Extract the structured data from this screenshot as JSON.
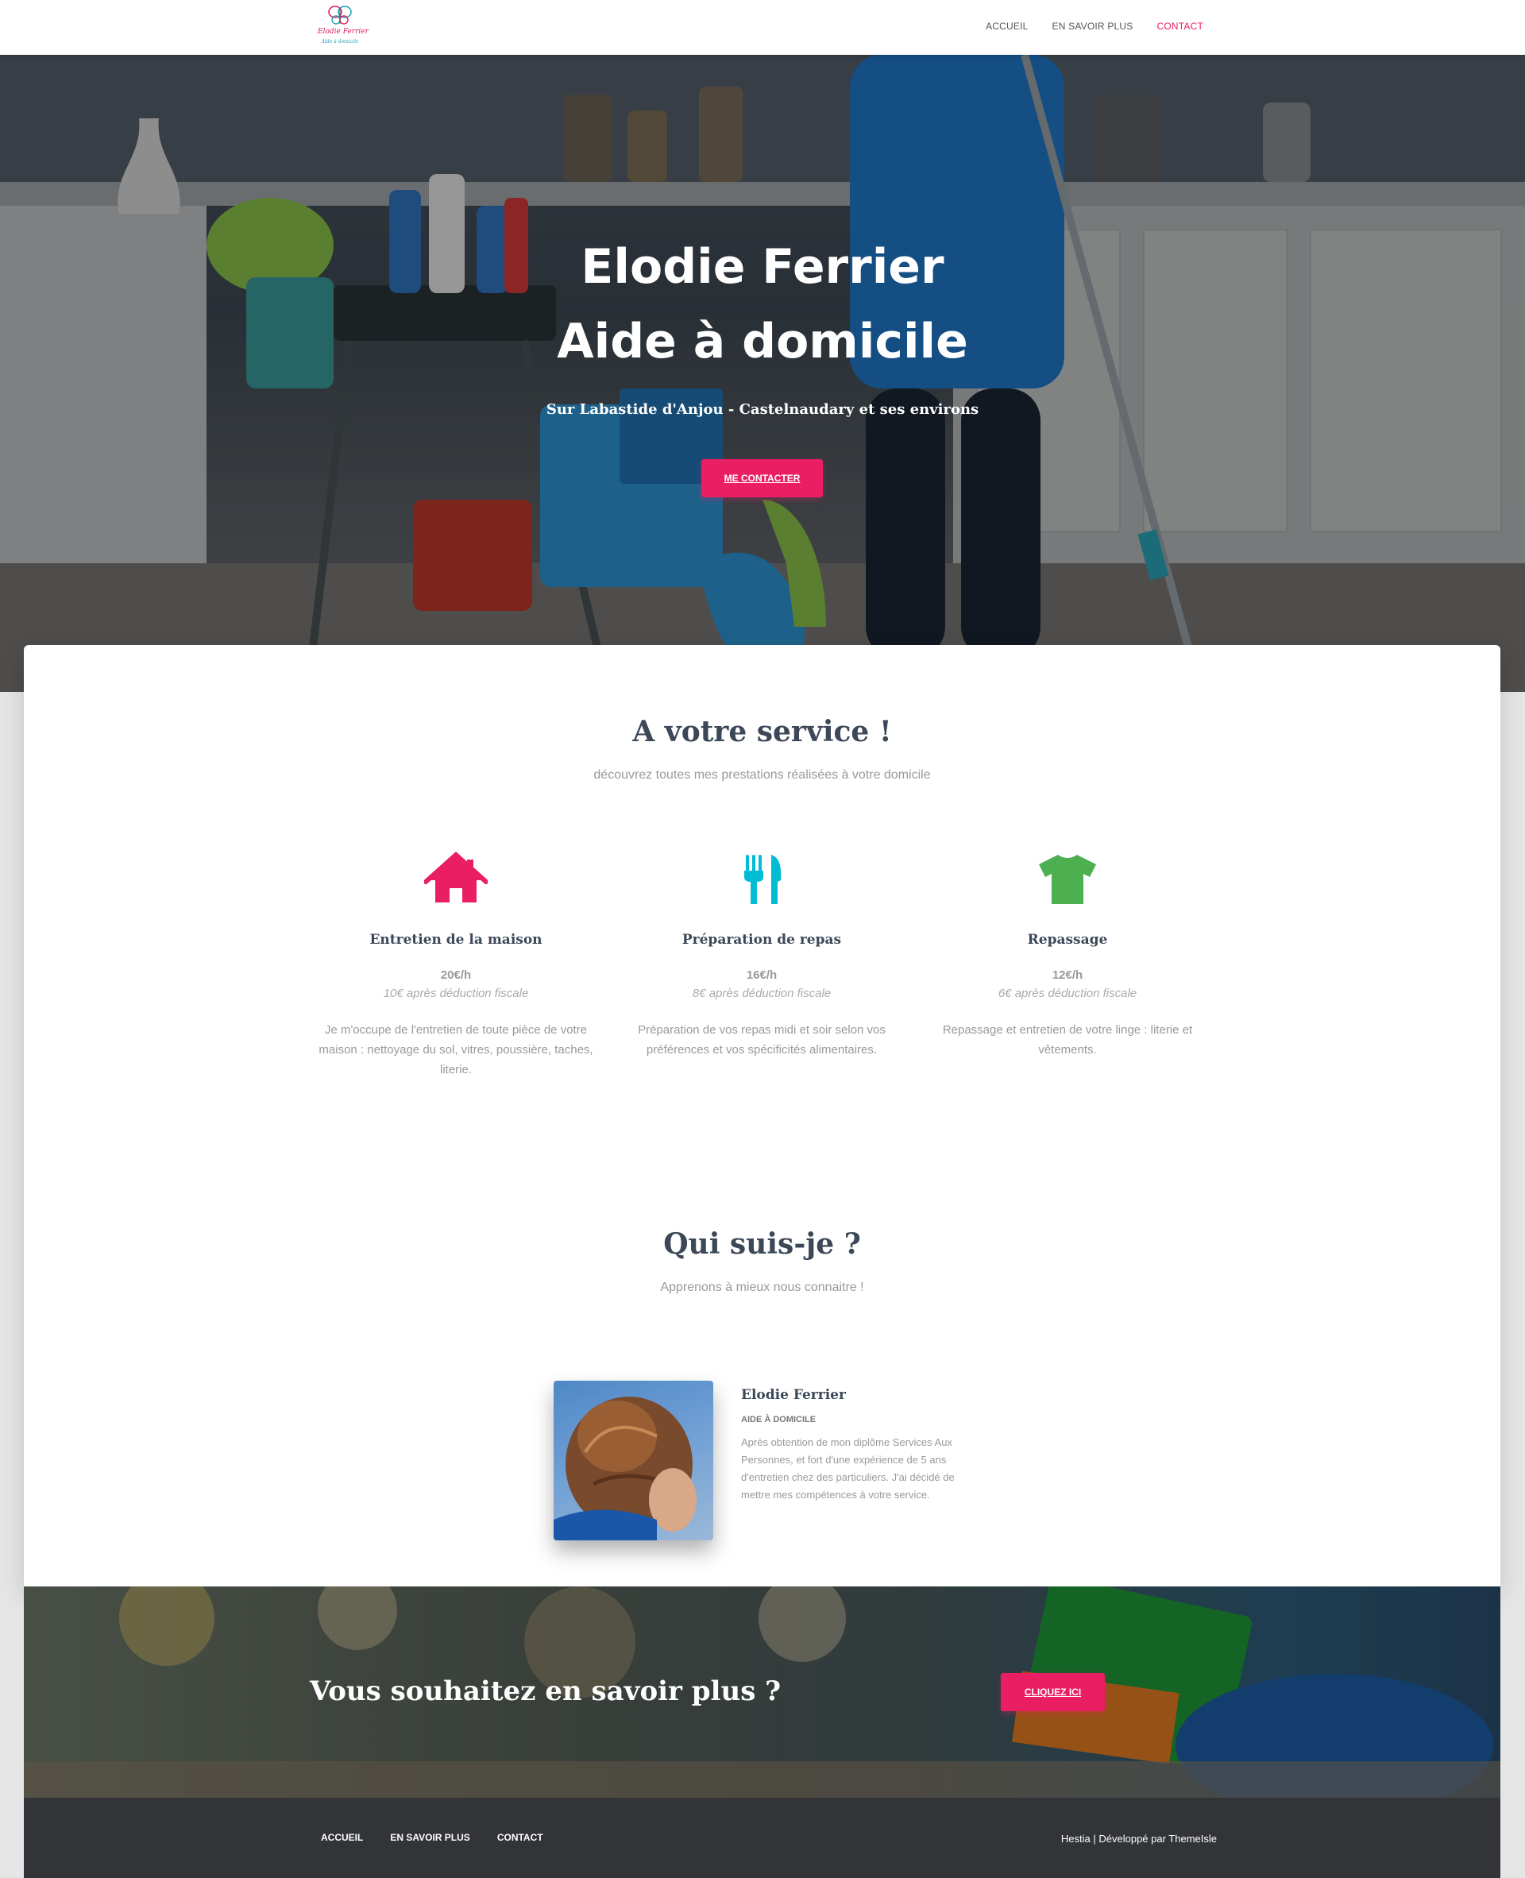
{
  "nav": {
    "brand": "Elodie Ferrier",
    "tagline": "Aide à domicile",
    "items": [
      "ACCUEIL",
      "EN SAVOIR PLUS",
      "CONTACT"
    ]
  },
  "hero": {
    "title_line1": "Elodie Ferrier",
    "title_line2": "Aide à domicile",
    "subtitle": "Sur Labastide d'Anjou - Castelnaudary et ses environs",
    "button": "ME CONTACTER"
  },
  "services": {
    "title": "A votre service !",
    "subtitle": "découvrez toutes mes prestations réalisées à votre domicile",
    "items": [
      {
        "icon": "home-icon",
        "color": "#e91e63",
        "name": "Entretien de la maison",
        "price": "20€/h",
        "note": "10€ après déduction fiscale",
        "desc": "Je m'occupe de l'entretien de toute pièce de votre maison : nettoyage du sol, vitres, poussière, taches, literie."
      },
      {
        "icon": "cutlery-icon",
        "color": "#00bcd4",
        "name": "Préparation de repas",
        "price": "16€/h",
        "note": "8€ après déduction fiscale",
        "desc": "Préparation de vos repas midi et soir selon vos préférences et vos spécificités alimentaires."
      },
      {
        "icon": "tshirt-icon",
        "color": "#4caf50",
        "name": "Repassage",
        "price": "12€/h",
        "note": "6€ après déduction fiscale",
        "desc": "Repassage et entretien de votre linge : literie et vêtements."
      }
    ]
  },
  "about": {
    "title": "Qui suis-je ?",
    "subtitle": "Apprenons à mieux nous connaitre !",
    "name": "Elodie Ferrier",
    "role": "AIDE À DOMICILE",
    "desc": "Après obtention de mon diplôme Services Aux Personnes, et fort d'une expérience de 5 ans d'entretien chez des particuliers. J'ai décidé de mettre mes compétences à votre service."
  },
  "cta": {
    "title": "Vous souhaitez en savoir plus ?",
    "button": "CLIQUEZ ICI"
  },
  "footer": {
    "items": [
      "ACCUEIL",
      "EN SAVOIR PLUS",
      "CONTACT"
    ],
    "copyright": "Hestia | Développé par ThemeIsle"
  }
}
